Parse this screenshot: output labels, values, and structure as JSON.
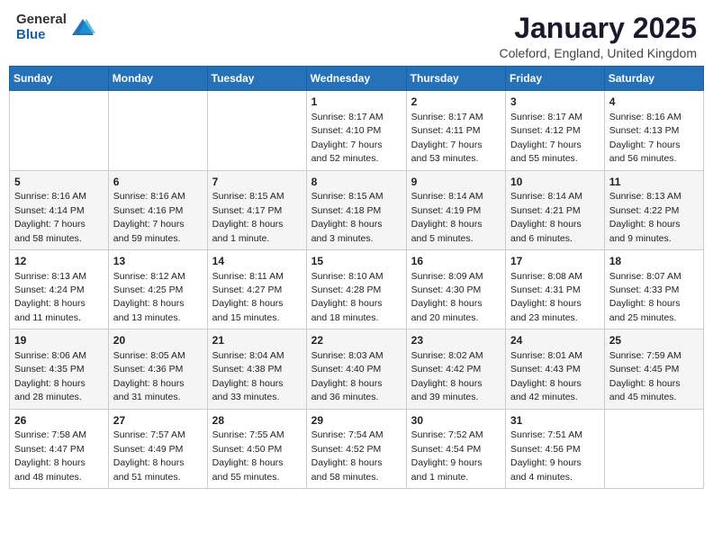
{
  "header": {
    "logo_general": "General",
    "logo_blue": "Blue",
    "month_title": "January 2025",
    "location": "Coleford, England, United Kingdom"
  },
  "days_of_week": [
    "Sunday",
    "Monday",
    "Tuesday",
    "Wednesday",
    "Thursday",
    "Friday",
    "Saturday"
  ],
  "weeks": [
    [
      {
        "day": "",
        "detail": ""
      },
      {
        "day": "",
        "detail": ""
      },
      {
        "day": "",
        "detail": ""
      },
      {
        "day": "1",
        "detail": "Sunrise: 8:17 AM\nSunset: 4:10 PM\nDaylight: 7 hours\nand 52 minutes."
      },
      {
        "day": "2",
        "detail": "Sunrise: 8:17 AM\nSunset: 4:11 PM\nDaylight: 7 hours\nand 53 minutes."
      },
      {
        "day": "3",
        "detail": "Sunrise: 8:17 AM\nSunset: 4:12 PM\nDaylight: 7 hours\nand 55 minutes."
      },
      {
        "day": "4",
        "detail": "Sunrise: 8:16 AM\nSunset: 4:13 PM\nDaylight: 7 hours\nand 56 minutes."
      }
    ],
    [
      {
        "day": "5",
        "detail": "Sunrise: 8:16 AM\nSunset: 4:14 PM\nDaylight: 7 hours\nand 58 minutes."
      },
      {
        "day": "6",
        "detail": "Sunrise: 8:16 AM\nSunset: 4:16 PM\nDaylight: 7 hours\nand 59 minutes."
      },
      {
        "day": "7",
        "detail": "Sunrise: 8:15 AM\nSunset: 4:17 PM\nDaylight: 8 hours\nand 1 minute."
      },
      {
        "day": "8",
        "detail": "Sunrise: 8:15 AM\nSunset: 4:18 PM\nDaylight: 8 hours\nand 3 minutes."
      },
      {
        "day": "9",
        "detail": "Sunrise: 8:14 AM\nSunset: 4:19 PM\nDaylight: 8 hours\nand 5 minutes."
      },
      {
        "day": "10",
        "detail": "Sunrise: 8:14 AM\nSunset: 4:21 PM\nDaylight: 8 hours\nand 6 minutes."
      },
      {
        "day": "11",
        "detail": "Sunrise: 8:13 AM\nSunset: 4:22 PM\nDaylight: 8 hours\nand 9 minutes."
      }
    ],
    [
      {
        "day": "12",
        "detail": "Sunrise: 8:13 AM\nSunset: 4:24 PM\nDaylight: 8 hours\nand 11 minutes."
      },
      {
        "day": "13",
        "detail": "Sunrise: 8:12 AM\nSunset: 4:25 PM\nDaylight: 8 hours\nand 13 minutes."
      },
      {
        "day": "14",
        "detail": "Sunrise: 8:11 AM\nSunset: 4:27 PM\nDaylight: 8 hours\nand 15 minutes."
      },
      {
        "day": "15",
        "detail": "Sunrise: 8:10 AM\nSunset: 4:28 PM\nDaylight: 8 hours\nand 18 minutes."
      },
      {
        "day": "16",
        "detail": "Sunrise: 8:09 AM\nSunset: 4:30 PM\nDaylight: 8 hours\nand 20 minutes."
      },
      {
        "day": "17",
        "detail": "Sunrise: 8:08 AM\nSunset: 4:31 PM\nDaylight: 8 hours\nand 23 minutes."
      },
      {
        "day": "18",
        "detail": "Sunrise: 8:07 AM\nSunset: 4:33 PM\nDaylight: 8 hours\nand 25 minutes."
      }
    ],
    [
      {
        "day": "19",
        "detail": "Sunrise: 8:06 AM\nSunset: 4:35 PM\nDaylight: 8 hours\nand 28 minutes."
      },
      {
        "day": "20",
        "detail": "Sunrise: 8:05 AM\nSunset: 4:36 PM\nDaylight: 8 hours\nand 31 minutes."
      },
      {
        "day": "21",
        "detail": "Sunrise: 8:04 AM\nSunset: 4:38 PM\nDaylight: 8 hours\nand 33 minutes."
      },
      {
        "day": "22",
        "detail": "Sunrise: 8:03 AM\nSunset: 4:40 PM\nDaylight: 8 hours\nand 36 minutes."
      },
      {
        "day": "23",
        "detail": "Sunrise: 8:02 AM\nSunset: 4:42 PM\nDaylight: 8 hours\nand 39 minutes."
      },
      {
        "day": "24",
        "detail": "Sunrise: 8:01 AM\nSunset: 4:43 PM\nDaylight: 8 hours\nand 42 minutes."
      },
      {
        "day": "25",
        "detail": "Sunrise: 7:59 AM\nSunset: 4:45 PM\nDaylight: 8 hours\nand 45 minutes."
      }
    ],
    [
      {
        "day": "26",
        "detail": "Sunrise: 7:58 AM\nSunset: 4:47 PM\nDaylight: 8 hours\nand 48 minutes."
      },
      {
        "day": "27",
        "detail": "Sunrise: 7:57 AM\nSunset: 4:49 PM\nDaylight: 8 hours\nand 51 minutes."
      },
      {
        "day": "28",
        "detail": "Sunrise: 7:55 AM\nSunset: 4:50 PM\nDaylight: 8 hours\nand 55 minutes."
      },
      {
        "day": "29",
        "detail": "Sunrise: 7:54 AM\nSunset: 4:52 PM\nDaylight: 8 hours\nand 58 minutes."
      },
      {
        "day": "30",
        "detail": "Sunrise: 7:52 AM\nSunset: 4:54 PM\nDaylight: 9 hours\nand 1 minute."
      },
      {
        "day": "31",
        "detail": "Sunrise: 7:51 AM\nSunset: 4:56 PM\nDaylight: 9 hours\nand 4 minutes."
      },
      {
        "day": "",
        "detail": ""
      }
    ]
  ]
}
